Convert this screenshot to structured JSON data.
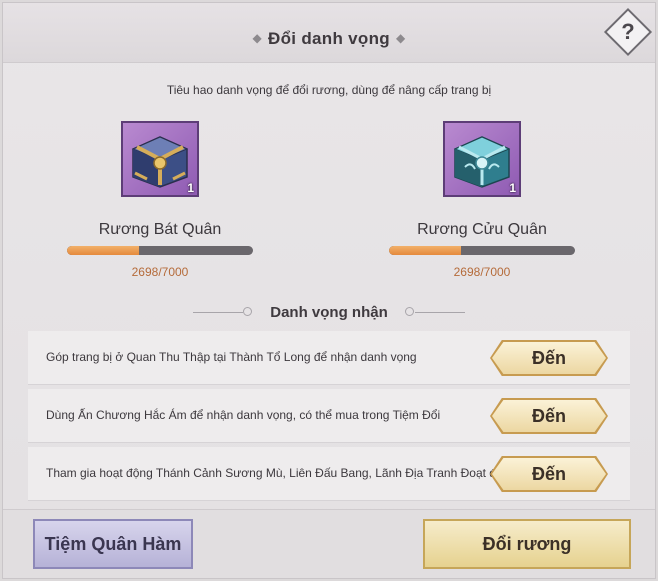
{
  "header": {
    "title": "Đổi danh vọng",
    "help_label": "?"
  },
  "subtitle": "Tiêu hao danh vọng để đổi rương, dùng để nâng cấp trang bị",
  "chests": [
    {
      "name": "Rương Bát Quân",
      "count": "1",
      "progress_text": "2698/7000",
      "progress_fraction": 0.385,
      "color": "#b98ad0",
      "icon": "gold-blue-chest-icon"
    },
    {
      "name": "Rương Cửu Quân",
      "count": "1",
      "progress_text": "2698/7000",
      "progress_fraction": 0.385,
      "color": "#b98ad0",
      "icon": "teal-chest-icon"
    }
  ],
  "section": {
    "title": "Danh vọng nhận"
  },
  "tasks": [
    {
      "text": "Góp trang bị ở Quan Thu Thập tại Thành Tổ Long để nhận danh vọng",
      "button": "Đến"
    },
    {
      "text": "Dùng Ấn Chương Hắc Ám để nhận danh vọng, có thể mua trong Tiệm Đổi",
      "button": "Đến"
    },
    {
      "text": "Tham gia hoạt động Thánh Cảnh Sương Mù, Liên Đấu Bang, Lãnh Địa Tranh Đoạt được nh",
      "button": "Đến"
    }
  ],
  "footer": {
    "shop_button": "Tiệm Quân Hàm",
    "exchange_button": "Đổi rương"
  },
  "colors": {
    "progress_fill": "#e58a3d",
    "progress_text": "#b56b3a",
    "go_button": "#ecd7a2",
    "shop_button": "#b6b2d7",
    "exchange_button": "#e6d28f"
  }
}
